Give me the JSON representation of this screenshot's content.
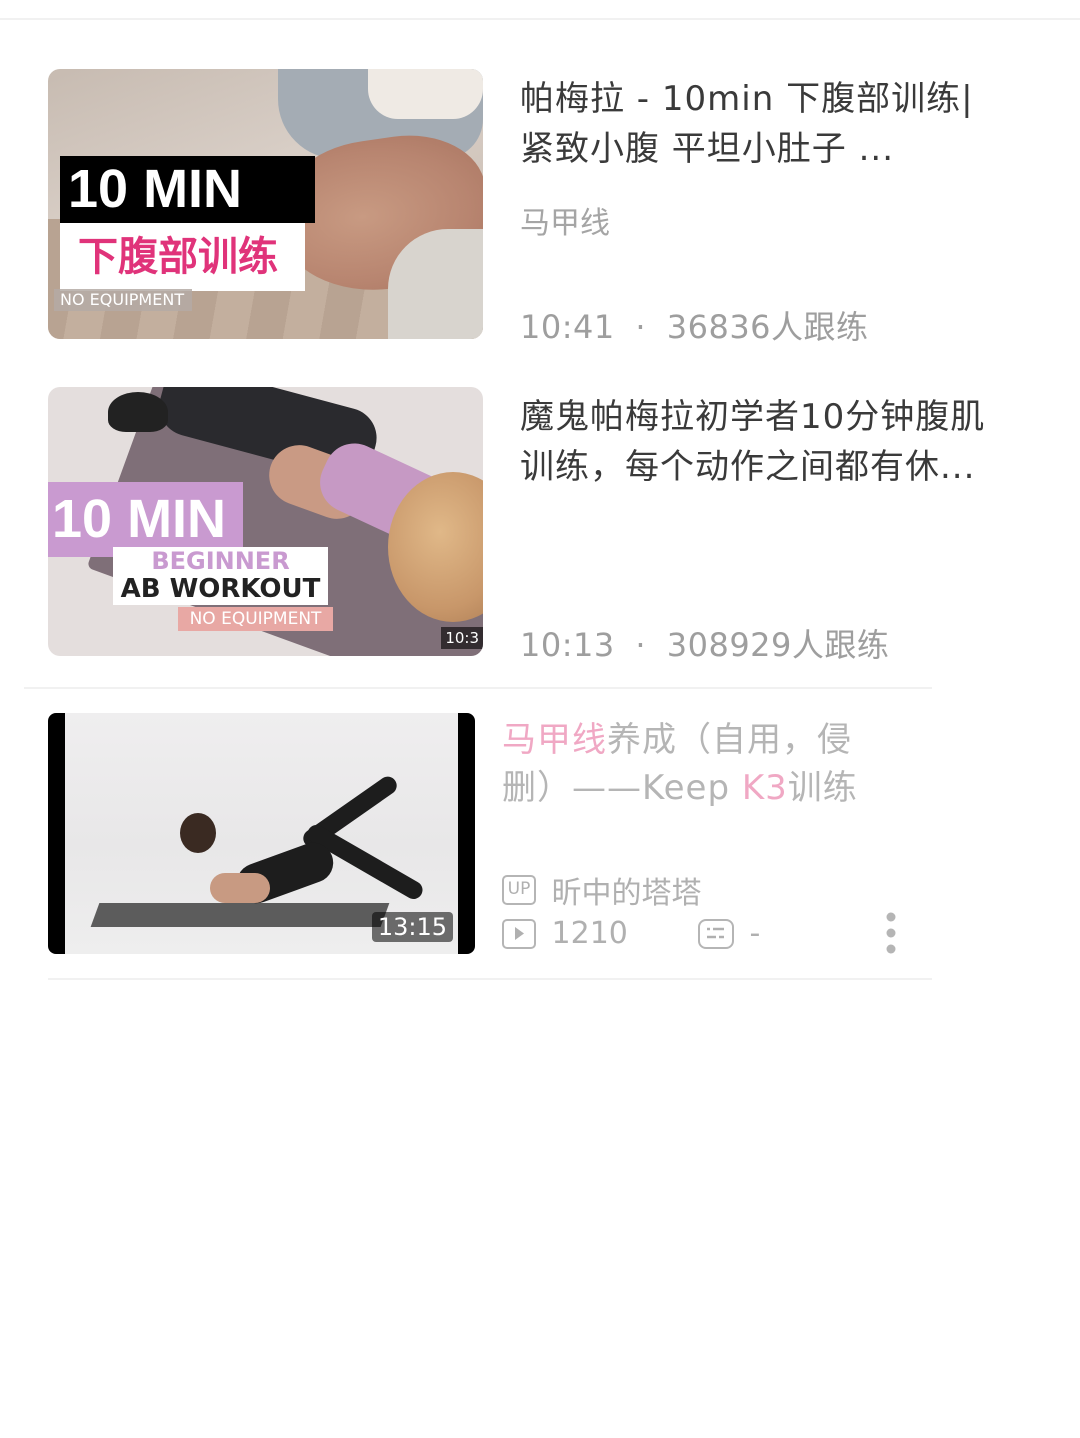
{
  "items": [
    {
      "title_line1": "帕梅拉 - 10min 下腹部训练|",
      "title_line2": "紧致小腹 平坦小肚子 ...",
      "subtitle": "马甲线",
      "duration": "10:41",
      "sep": "·",
      "followers": "36836人跟练",
      "thumb": {
        "band_main": "10 MIN",
        "band_cn": "下腹部训练",
        "band_small": "NO EQUIPMENT"
      }
    },
    {
      "title_line1": "魔鬼帕梅拉初学者10分钟腹肌",
      "title_line2": "训练，每个动作之间都有休...",
      "duration": "10:13",
      "sep": "·",
      "followers": "308929人跟练",
      "thumb": {
        "band_main": "10 MIN",
        "band_l1": "BEGINNER",
        "band_l2": "AB WORKOUT",
        "band_small": "NO EQUIPMENT",
        "badge": "10:3"
      }
    },
    {
      "title_hl1": "马甲线",
      "title_rest1": "养成（自用，侵",
      "title_rest2a": "删）——Keep ",
      "title_hl2": "K3",
      "title_rest2b": "训练",
      "up_label": "UP",
      "uploader": "昕中的塔塔",
      "plays": "1210",
      "danmaku": "-",
      "thumb": {
        "duration": "13:15"
      }
    }
  ],
  "colors": {
    "accent_pink": "#f0a8c4",
    "title": "#3a3a3a",
    "meta": "#9e9e9e"
  },
  "icons": [
    "play-count-icon",
    "danmaku-icon",
    "more-vertical-icon",
    "up-badge-icon"
  ]
}
